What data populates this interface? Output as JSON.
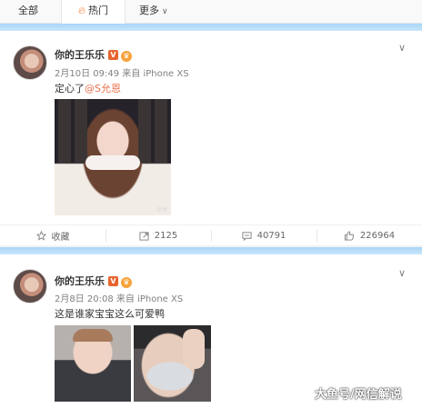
{
  "tabs": {
    "all": "全部",
    "hot": "热门",
    "more": "更多"
  },
  "posts": [
    {
      "username": "你的王乐乐",
      "vip_badge": "V",
      "meta": "2月10日 09:49 来自 iPhone XS",
      "text_prefix": "定心了",
      "mention": "@S允恩",
      "photo_watermark": "微博",
      "actions": {
        "favorite": "收藏",
        "repost_count": "2125",
        "comment_count": "40791",
        "like_count": "226964"
      }
    },
    {
      "username": "你的王乐乐",
      "vip_badge": "V",
      "meta": "2月8日 20:08 来自 iPhone XS",
      "text": "这是谁家宝宝这么可爱鸭"
    }
  ],
  "watermark": "大鱼号/网信解说",
  "colors": {
    "accent": "#fa7d3c",
    "mention": "#eb7350",
    "strip": "#a9d6f7"
  },
  "icons": [
    "flame-icon",
    "chevron-down-icon",
    "star-icon",
    "repost-icon",
    "comment-icon",
    "like-icon"
  ]
}
